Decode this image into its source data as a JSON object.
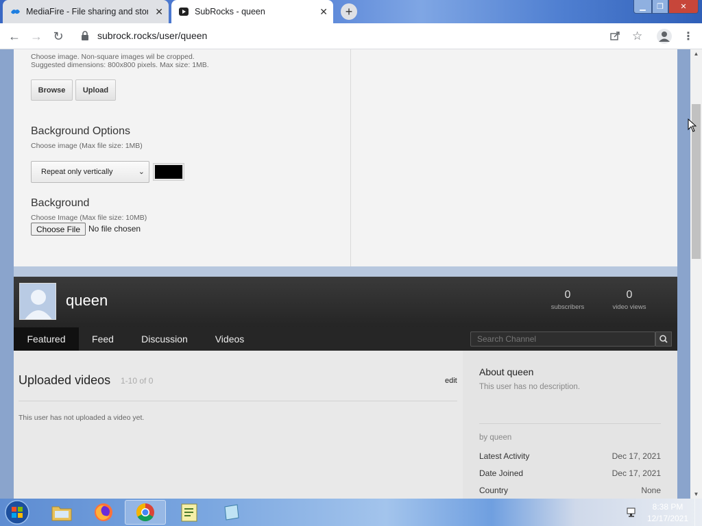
{
  "browser": {
    "tabs": [
      {
        "title": "MediaFire - File sharing and storage",
        "active": false
      },
      {
        "title": "SubRocks - queen",
        "active": true
      }
    ],
    "new_tab_symbol": "+",
    "url": "subrock.rocks/user/queen"
  },
  "editor": {
    "image_hint_1": "Choose image. Non-square images wil be cropped.",
    "image_hint_2": "Suggested dimensions: 800x800 pixels. Max size: 1MB.",
    "browse_label": "Browse",
    "upload_label": "Upload",
    "bg_options_title": "Background Options",
    "bg_options_hint": "Choose image (Max file size: 1MB)",
    "repeat_selected": "Repeat only vertically",
    "bg_color": "#000000",
    "background_title": "Background",
    "background_hint": "Choose Image (Max file size: 10MB)",
    "choose_file_label": "Choose File",
    "no_file_text": "No file chosen"
  },
  "channel": {
    "name": "queen",
    "subscribers": "0",
    "subscribers_label": "subscribers",
    "video_views": "0",
    "video_views_label": "video views",
    "nav": [
      "Featured",
      "Feed",
      "Discussion",
      "Videos"
    ],
    "search_placeholder": "Search Channel"
  },
  "content": {
    "uploaded_title": "Uploaded videos",
    "uploaded_count": "1-10 of 0",
    "edit_label": "edit",
    "no_videos_text": "This user has not uploaded a video yet."
  },
  "sidebar": {
    "about_title": "About queen",
    "about_desc": "This user has no description.",
    "by_line": "by queen",
    "meta": [
      {
        "label": "Latest Activity",
        "value": "Dec 17, 2021"
      },
      {
        "label": "Date Joined",
        "value": "Dec 17, 2021"
      },
      {
        "label": "Country",
        "value": "None"
      }
    ]
  },
  "taskbar": {
    "time": "8:38 PM",
    "date": "12/17/2021"
  },
  "colors": {
    "channel_header": "#2f2f2f",
    "active_nav": "#111111",
    "page_background": "#8aa4cc"
  }
}
